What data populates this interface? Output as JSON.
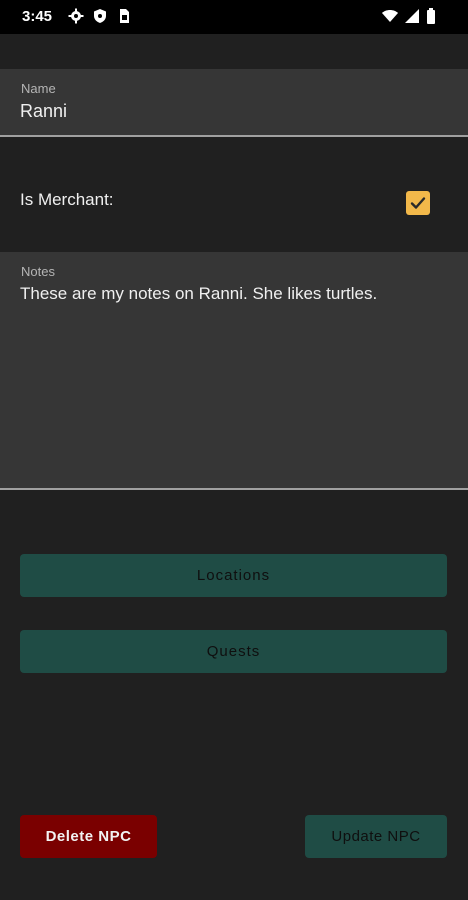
{
  "status_bar": {
    "time": "3:45",
    "left_icons": [
      "settings-icon",
      "shield-icon",
      "sim-card-icon"
    ],
    "right_icons": [
      "wifi-icon",
      "signal-icon",
      "battery-icon"
    ]
  },
  "form": {
    "name": {
      "label": "Name",
      "value": "Ranni"
    },
    "merchant": {
      "label": "Is Merchant:",
      "checked": true
    },
    "notes": {
      "label": "Notes",
      "value": "These are my notes on Ranni. She likes turtles."
    }
  },
  "buttons": {
    "locations": "Locations",
    "quests": "Quests",
    "delete": "Delete NPC",
    "update": "Update NPC"
  },
  "colors": {
    "background": "#202020",
    "field_background": "#363636",
    "accent_checkbox": "#f2b84a",
    "teal_button": "#1f4c45",
    "delete_button": "#7a0000"
  }
}
